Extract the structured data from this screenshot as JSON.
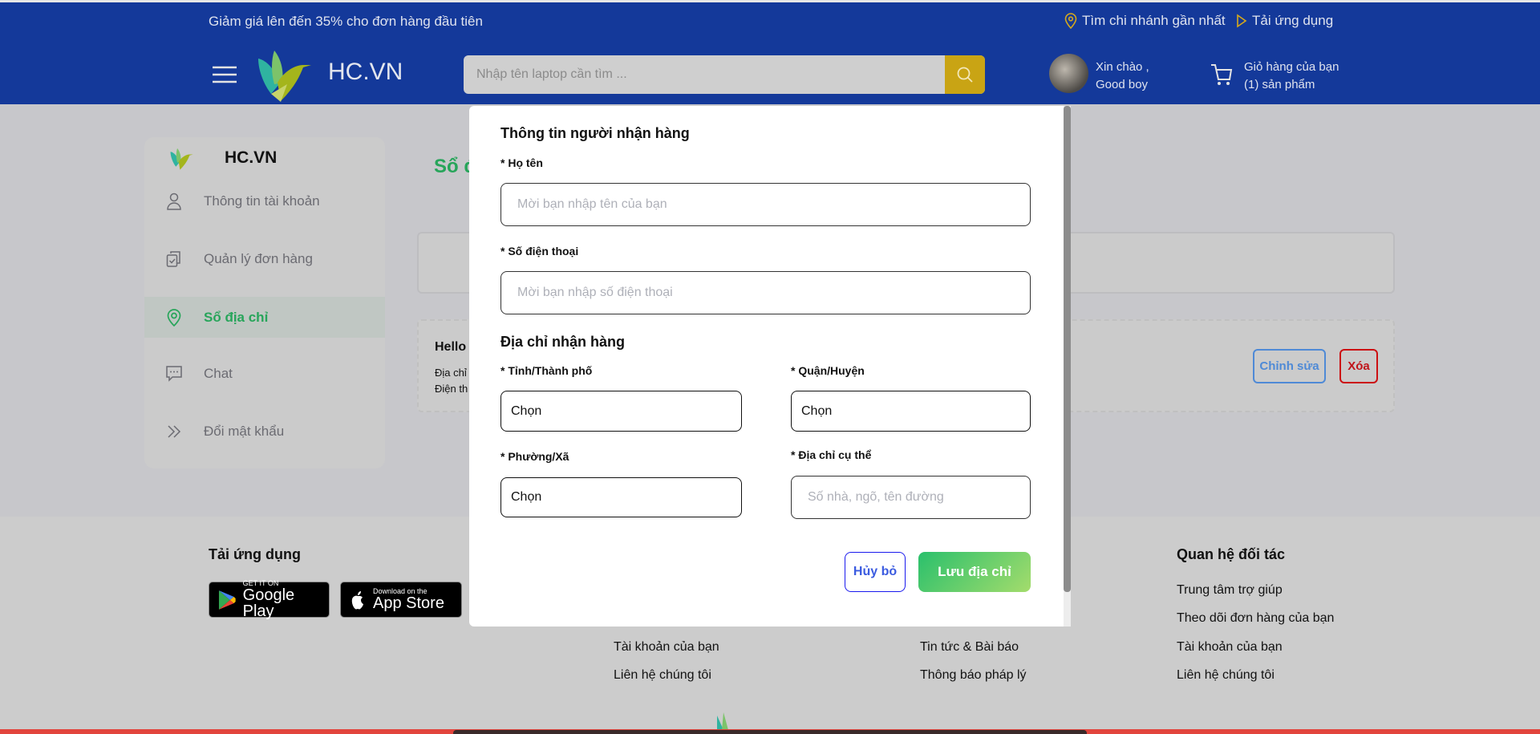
{
  "topbar": {
    "promo": "Giảm giá lên đến 35% cho đơn hàng đầu tiên",
    "store_link": "Tìm chi nhánh gần nhất",
    "app_link": "Tải ứng dụng"
  },
  "header": {
    "logo_text": "HC.VN",
    "search_placeholder": "Nhập tên laptop cần tìm ...",
    "greeting": "Xin chào ,",
    "username": "Good boy",
    "cart_title": "Giỏ hàng của bạn",
    "cart_count": "(1) sản phẩm",
    "accent": "#14399a",
    "search_button_color": "#c9a414"
  },
  "sidebar": {
    "logo_text": "HC.VN",
    "items": [
      {
        "label": "Thông tin tài khoản",
        "icon": "user-icon"
      },
      {
        "label": "Quản lý đơn hàng",
        "icon": "clipboard-icon"
      },
      {
        "label": "Sổ địa chỉ",
        "icon": "location-icon",
        "active": true
      },
      {
        "label": "Chat",
        "icon": "chat-icon"
      },
      {
        "label": "Đổi mật khẩu",
        "icon": "double-chevron-icon"
      }
    ]
  },
  "main": {
    "title": "Sổ đ",
    "address_card": {
      "name": "Hello ",
      "address_label": "Địa chỉ",
      "phone_label": "Điện th",
      "edit_label": "Chỉnh sửa",
      "delete_label": "Xóa"
    }
  },
  "footer": {
    "app_heading": "Tải ứng dụng",
    "google_play": {
      "small": "GET IT ON",
      "big": "Google Play"
    },
    "app_store": {
      "small": "Download on the",
      "big": "App Store"
    },
    "col1": [
      "Tài khoản của bạn",
      "Liên hệ chúng tôi"
    ],
    "col2": [
      "Tin tức & Bài báo",
      "Thông báo pháp lý"
    ],
    "partner_heading": "Quan hệ đối tác",
    "col3": [
      "Trung tâm trợ giúp",
      "Theo dõi đơn hàng của bạn",
      "Tài khoản của bạn",
      "Liên hệ chúng tôi"
    ]
  },
  "modal": {
    "receiver_heading": "Thông tin người nhận hàng",
    "name_label": "* Họ tên",
    "name_placeholder": "Mời bạn nhập tên của bạn",
    "phone_label": "* Số điện thoại",
    "phone_placeholder": "Mời bạn nhập số điện thoại",
    "address_heading": "Địa chỉ nhận hàng",
    "province_label": "* Tỉnh/Thành phố",
    "province_value": "Chọn",
    "district_label": "* Quận/Huyện",
    "district_value": "Chọn",
    "ward_label": "* Phường/Xã",
    "ward_value": "Chọn",
    "street_label": "* Địa chỉ cụ thể",
    "street_placeholder": "Số nhà, ngõ, tên đường",
    "cancel_label": "Hủy bỏ",
    "save_label": "Lưu địa chỉ"
  }
}
